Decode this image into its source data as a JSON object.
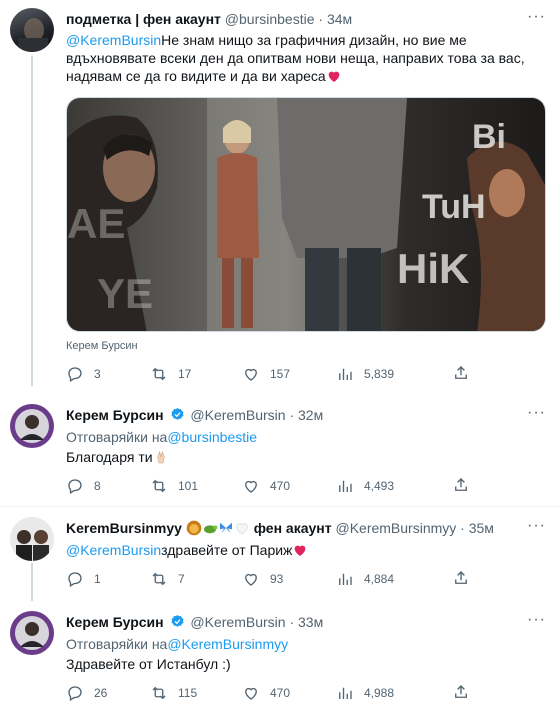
{
  "tweets": [
    {
      "name": "подметка | фен акаунт",
      "handle": "@bursinbestie",
      "dot": "·",
      "time": "34м",
      "mention": "@KeremBursin",
      "text": "Не знам нищо за графичния дизайн, но вие ме вдъхновявате всеки ден да опитвам нови неща, направих това за вас, надявам се да го видите и да ви хареса",
      "media_caption": "Керем Бурсин",
      "media_overlay": [
        "Bi",
        "TuH",
        "HiK",
        "AE",
        "YE"
      ],
      "counts": {
        "reply": "3",
        "retweet": "17",
        "like": "157",
        "views": "5,839"
      }
    },
    {
      "name": "Керем Бурсин",
      "handle": "@KeremBursin",
      "dot": "·",
      "time": "32м",
      "reply_prefix": "Отговаряйки на",
      "reply_mention": "@bursinbestie",
      "text": "Благодаря ти",
      "counts": {
        "reply": "8",
        "retweet": "101",
        "like": "470",
        "views": "4,493"
      }
    },
    {
      "name": "KeremBursinmyy",
      "name_suffix": "фен акаунт",
      "handle": "@KeremBursinmyy",
      "dot": "·",
      "time": "35м",
      "mention": "@KeremBursin",
      "text": "здравейте от Париж",
      "counts": {
        "reply": "1",
        "retweet": "7",
        "like": "93",
        "views": "4,884"
      }
    },
    {
      "name": "Керем Бурсин",
      "handle": "@KeremBursin",
      "dot": "·",
      "time": "33м",
      "reply_prefix": "Отговаряйки на",
      "reply_mention": "@KeremBursinmyy",
      "text": "Здравейте от Истанбул :)",
      "counts": {
        "reply": "26",
        "retweet": "115",
        "like": "470",
        "views": "4,988"
      }
    }
  ],
  "colors": {
    "accent": "#1d9bf0",
    "muted": "#536471",
    "heart": "#e0245e",
    "verified": "#1d9bf0"
  },
  "icons": [
    "reply-icon",
    "retweet-icon",
    "like-icon",
    "views-icon",
    "share-icon",
    "verified-badge-icon",
    "more-icon"
  ]
}
